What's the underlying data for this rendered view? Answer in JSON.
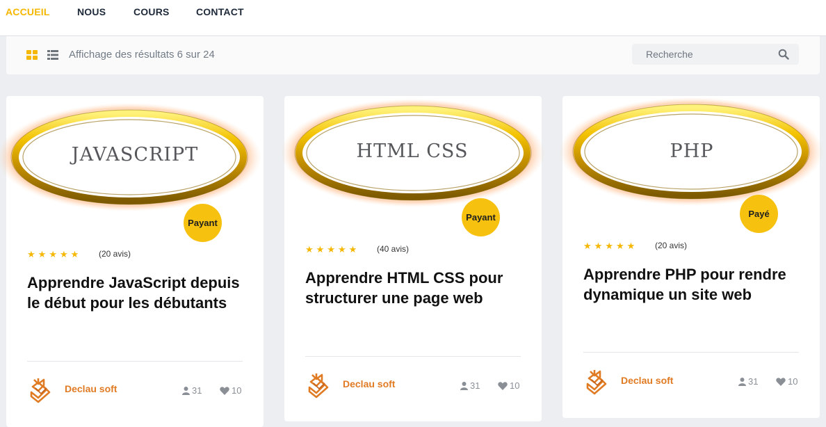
{
  "nav": {
    "items": [
      {
        "label": "ACCUEIL",
        "active": true
      },
      {
        "label": "NOUS",
        "active": false
      },
      {
        "label": "COURS",
        "active": false
      },
      {
        "label": "CONTACT",
        "active": false
      }
    ]
  },
  "toolbar": {
    "grid_view_icon": "grid-icon",
    "list_view_icon": "list-icon",
    "result_text": "Affichage des résultats 6 sur 24",
    "search_placeholder": "Recherche",
    "search_icon": "search-icon"
  },
  "colors": {
    "accent": "#f5b700",
    "author": "#e07b24",
    "badge": "#f6c10f"
  },
  "courses": [
    {
      "image_label": "JAVASCRIPT",
      "badge": "Payant",
      "rating": 5,
      "reviews": "(20 avis)",
      "title": "Apprendre JavaScript depuis le début pour les débutants",
      "author": "Declau soft",
      "students": "31",
      "likes": "10"
    },
    {
      "image_label": "HTML CSS",
      "badge": "Payant",
      "rating": 5,
      "reviews": "(40 avis)",
      "title": "Apprendre HTML CSS pour structurer une page web",
      "author": "Declau soft",
      "students": "31",
      "likes": "10"
    },
    {
      "image_label": "PHP",
      "badge": "Payé",
      "rating": 5,
      "reviews": "(20 avis)",
      "title": "Apprendre PHP pour rendre dynamique un site web",
      "author": "Declau soft",
      "students": "31",
      "likes": "10"
    }
  ]
}
